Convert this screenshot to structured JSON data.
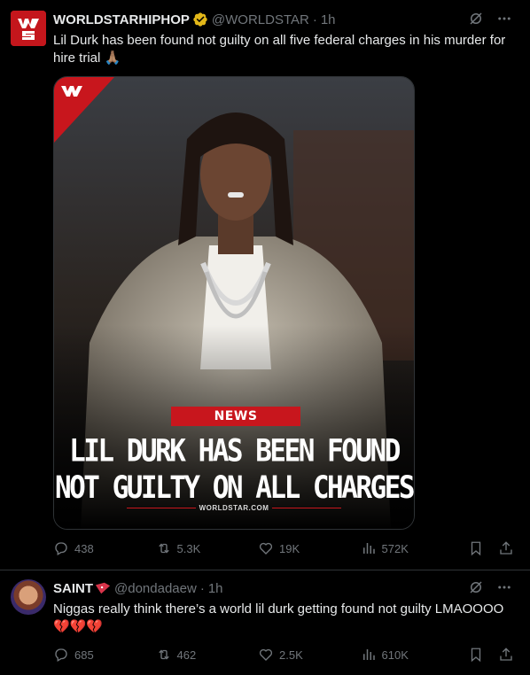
{
  "tweets": [
    {
      "author": "WORLDSTARHIPHOP",
      "handle": "@WORLDSTAR",
      "dot": "·",
      "time": "1h",
      "text": "Lil Durk has been found not guilty on all five federal charges in his murder for hire trial 🙏🏽",
      "media": {
        "tag": "NEWS",
        "headline_line1": "LIL DURK HAS BEEN FOUND",
        "headline_line2": "NOT GUILTY ON ALL CHARGES",
        "footer": "WORLDSTAR.COM"
      },
      "stats": {
        "replies": "438",
        "reposts": "5.3K",
        "likes": "19K",
        "views": "572K"
      }
    },
    {
      "author": "SAINT",
      "handle": "@dondadaew",
      "dot": "·",
      "time": "1h",
      "text": "Niggas really think there’s a world lil durk getting found not guilty LMAOOOO 💔💔💔",
      "stats": {
        "replies": "685",
        "reposts": "462",
        "likes": "2.5K",
        "views": "610K"
      }
    }
  ],
  "colors": {
    "background": "#000000",
    "text": "#e7e9ea",
    "muted": "#71767b",
    "brand_red": "#c8161d",
    "verified_gold": "#e2b719"
  }
}
